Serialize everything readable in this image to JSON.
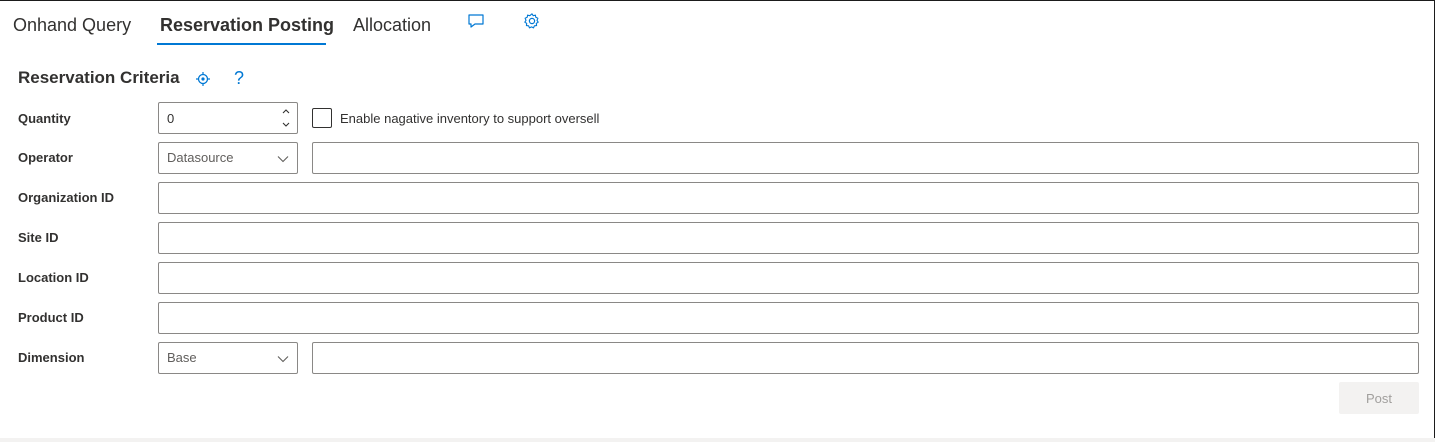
{
  "tabs": [
    {
      "label": "Onhand Query"
    },
    {
      "label": "Reservation Posting",
      "selected": true
    },
    {
      "label": "Allocation"
    }
  ],
  "tab_icons": [
    "comment-icon",
    "settings-gear-icon"
  ],
  "section": {
    "title": "Reservation Criteria",
    "icons": [
      "reset-criteria-icon",
      "help-question-icon"
    ]
  },
  "form": {
    "quantity": {
      "label": "Quantity",
      "value": "0"
    },
    "oversell": {
      "label": "Enable nagative inventory to support oversell",
      "checked": false
    },
    "operator": {
      "label": "Operator",
      "selected": "Datasource",
      "value": ""
    },
    "organization": {
      "label": "Organization ID",
      "value": ""
    },
    "site": {
      "label": "Site ID",
      "value": ""
    },
    "location": {
      "label": "Location ID",
      "value": ""
    },
    "product": {
      "label": "Product ID",
      "value": ""
    },
    "dimension": {
      "label": "Dimension",
      "selected": "Base",
      "value": ""
    }
  },
  "actions": {
    "post_label": "Post",
    "post_enabled": false
  },
  "colors": {
    "accent": "#0078d4",
    "border": "#8a8886",
    "text": "#323130"
  }
}
